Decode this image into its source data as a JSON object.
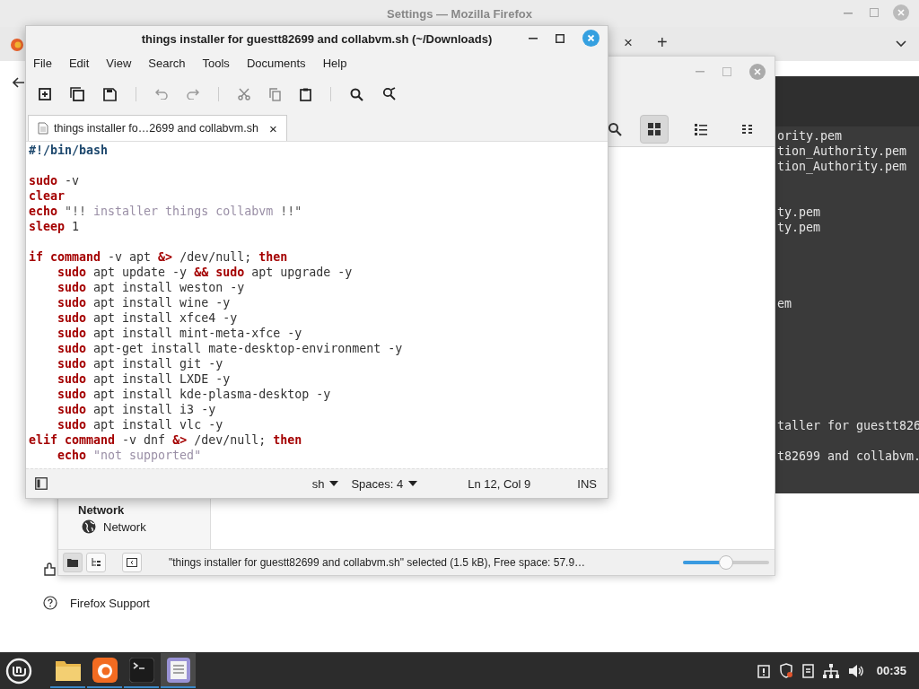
{
  "firefox": {
    "window_title": "Settings — Mozilla Firefox",
    "tab_close": "×",
    "new_tab": "+",
    "support_link": "Firefox Support"
  },
  "terminal": {
    "lines": [
      {
        "kind": "text",
        "text": "ority.pem"
      },
      {
        "kind": "text",
        "text": "tion_Authority.pem"
      },
      {
        "kind": "text",
        "text": "tion_Authority.pem"
      },
      {
        "kind": "blank"
      },
      {
        "kind": "blank"
      },
      {
        "kind": "text",
        "text": "ty.pem"
      },
      {
        "kind": "text",
        "text": "ty.pem"
      },
      {
        "kind": "blank"
      },
      {
        "kind": "blank"
      },
      {
        "kind": "blank"
      },
      {
        "kind": "blank"
      },
      {
        "kind": "text",
        "text": "em"
      },
      {
        "kind": "blank"
      },
      {
        "kind": "blank"
      },
      {
        "kind": "blank"
      },
      {
        "kind": "blank"
      },
      {
        "kind": "blank"
      },
      {
        "kind": "blank"
      },
      {
        "kind": "blank"
      },
      {
        "kind": "text",
        "text": "taller for guestt826"
      },
      {
        "kind": "blank"
      },
      {
        "kind": "text",
        "text": "t82699 and collabvm."
      }
    ]
  },
  "file_manager": {
    "view_buttons": [
      {
        "kind": "grid",
        "selected": true
      },
      {
        "kind": "list",
        "selected": false
      },
      {
        "kind": "compact",
        "selected": false
      }
    ],
    "sidebar": {
      "heading": "Network",
      "items": [
        {
          "label": "Network"
        }
      ]
    },
    "status_text": "\"things installer for guestt82699 and collabvm.sh\" selected (1.5 kB), Free space: 57.9…",
    "zoom": {
      "level": 0.5
    }
  },
  "editor": {
    "title": "things installer for guestt82699 and collabvm.sh (~/Downloads)",
    "menu": [
      "File",
      "Edit",
      "View",
      "Search",
      "Tools",
      "Documents",
      "Help"
    ],
    "tabs": [
      {
        "label": "things installer fo…2699 and collabvm.sh",
        "selected": true
      }
    ],
    "tab_close": "×",
    "lines": [
      {
        "kind": "code",
        "tokens": [
          {
            "text": "#!/bin/bash",
            "kind": "shebang"
          }
        ]
      },
      {
        "kind": "blank"
      },
      {
        "kind": "code",
        "tokens": [
          {
            "text": "sudo",
            "kind": "kw"
          },
          {
            "text": " -v",
            "kind": "plain"
          }
        ]
      },
      {
        "kind": "code",
        "tokens": [
          {
            "text": "clear",
            "kind": "kw"
          }
        ]
      },
      {
        "kind": "code",
        "tokens": [
          {
            "text": "echo",
            "kind": "kw"
          },
          {
            "text": " \"!! ",
            "kind": "quote"
          },
          {
            "text": "installer things collabvm",
            "kind": "str"
          },
          {
            "text": " !!\"",
            "kind": "quote"
          }
        ]
      },
      {
        "kind": "code",
        "tokens": [
          {
            "text": "sleep",
            "kind": "kw"
          },
          {
            "text": " 1",
            "kind": "plain"
          }
        ]
      },
      {
        "kind": "blank"
      },
      {
        "kind": "code",
        "tokens": [
          {
            "text": "if command",
            "kind": "kw"
          },
          {
            "text": " -v apt ",
            "kind": "plain"
          },
          {
            "text": "&>",
            "kind": "kw"
          },
          {
            "text": " /dev/null; ",
            "kind": "plain"
          },
          {
            "text": "then",
            "kind": "kw"
          }
        ]
      },
      {
        "kind": "code",
        "tokens": [
          {
            "text": "    sudo",
            "kind": "kw"
          },
          {
            "text": " apt update -y ",
            "kind": "plain"
          },
          {
            "text": "&&",
            "kind": "kw"
          },
          {
            "text": " sudo",
            "kind": "kw"
          },
          {
            "text": " apt upgrade -y",
            "kind": "plain"
          }
        ]
      },
      {
        "kind": "code",
        "tokens": [
          {
            "text": "    sudo",
            "kind": "kw"
          },
          {
            "text": " apt install weston -y",
            "kind": "plain"
          }
        ]
      },
      {
        "kind": "code",
        "tokens": [
          {
            "text": "    sudo",
            "kind": "kw"
          },
          {
            "text": " apt install wine -y",
            "kind": "plain"
          }
        ]
      },
      {
        "kind": "code",
        "tokens": [
          {
            "text": "    sudo",
            "kind": "kw"
          },
          {
            "text": " apt install xfce4 -y",
            "kind": "plain"
          }
        ]
      },
      {
        "kind": "code",
        "tokens": [
          {
            "text": "    sudo",
            "kind": "kw"
          },
          {
            "text": " apt install mint-meta-xfce -y",
            "kind": "plain"
          }
        ]
      },
      {
        "kind": "code",
        "tokens": [
          {
            "text": "    sudo",
            "kind": "kw"
          },
          {
            "text": " apt-get install mate-desktop-environment -y",
            "kind": "plain"
          }
        ]
      },
      {
        "kind": "code",
        "tokens": [
          {
            "text": "    sudo",
            "kind": "kw"
          },
          {
            "text": " apt install git -y",
            "kind": "plain"
          }
        ]
      },
      {
        "kind": "code",
        "tokens": [
          {
            "text": "    sudo",
            "kind": "kw"
          },
          {
            "text": " apt install LXDE -y",
            "kind": "plain"
          }
        ]
      },
      {
        "kind": "code",
        "tokens": [
          {
            "text": "    sudo",
            "kind": "kw"
          },
          {
            "text": " apt install kde-plasma-desktop -y",
            "kind": "plain"
          }
        ]
      },
      {
        "kind": "code",
        "tokens": [
          {
            "text": "    sudo",
            "kind": "kw"
          },
          {
            "text": " apt install i3 -y",
            "kind": "plain"
          }
        ]
      },
      {
        "kind": "code",
        "tokens": [
          {
            "text": "    sudo",
            "kind": "kw"
          },
          {
            "text": " apt install vlc -y",
            "kind": "plain"
          }
        ]
      },
      {
        "kind": "code",
        "tokens": [
          {
            "text": "elif command",
            "kind": "kw"
          },
          {
            "text": " -v dnf ",
            "kind": "plain"
          },
          {
            "text": "&>",
            "kind": "kw"
          },
          {
            "text": " /dev/null; ",
            "kind": "plain"
          },
          {
            "text": "then",
            "kind": "kw"
          }
        ]
      },
      {
        "kind": "code",
        "tokens": [
          {
            "text": "    echo",
            "kind": "kw"
          },
          {
            "text": " \"not supported\"",
            "kind": "str"
          }
        ]
      }
    ],
    "status": {
      "language": "sh",
      "spaces": "Spaces: 4",
      "position": "Ln 12, Col 9",
      "mode": "INS"
    }
  },
  "taskbar": {
    "apps": [
      {
        "kind": "files",
        "active": false
      },
      {
        "kind": "firefox",
        "active": false
      },
      {
        "kind": "terminal",
        "active": false
      },
      {
        "kind": "editor",
        "active": true
      }
    ],
    "clock": "00:35"
  }
}
